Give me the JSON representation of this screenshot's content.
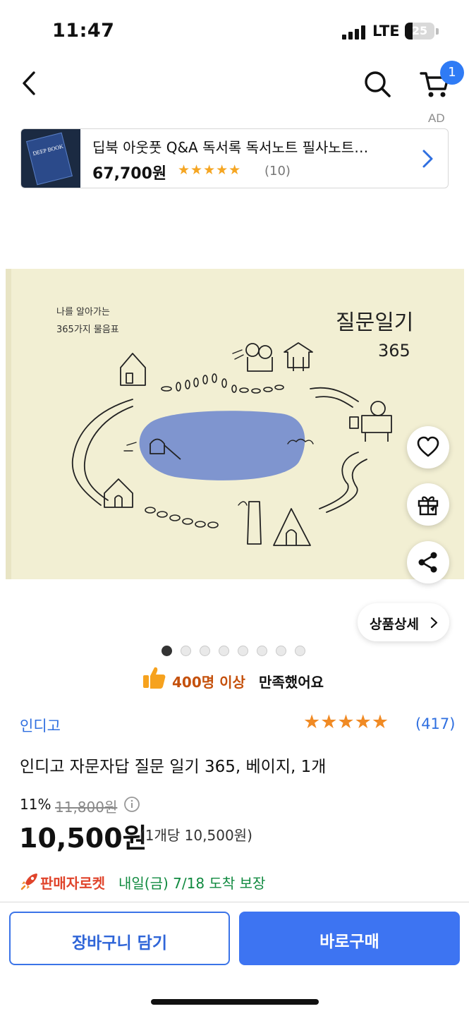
{
  "status_bar": {
    "time": "11:47",
    "network": "LTE",
    "battery": "25",
    "battery_level": 0.25
  },
  "nav": {
    "back_icon": "chevron-left-icon",
    "search_icon": "search-icon",
    "cart_icon": "cart-icon",
    "cart_badge": "1"
  },
  "ad": {
    "label": "AD",
    "title": "딥북 아웃풋 Q&A 독서록 독서노트 필사노트…",
    "price": "67,700원",
    "stars": "★★★★★",
    "rating": 5,
    "reviews": "(10)",
    "thumb_text": "DEEP BOOK"
  },
  "cover": {
    "tagline_line1": "나를 알아가는",
    "tagline_line2": "365가지 물음표",
    "title": "질문일기",
    "number": "365"
  },
  "actions": {
    "wishlist_icon": "heart-icon",
    "gift_icon": "gift-icon",
    "share_icon": "share-icon"
  },
  "detail_button": {
    "label": "상품상세"
  },
  "carousel": {
    "total": 8,
    "active": 1
  },
  "satisfaction": {
    "highlight": "400명 이상",
    "rest": "만족했어요"
  },
  "product": {
    "brand": "인디고",
    "stars": "★★★★★",
    "rating": 5,
    "reviews": "(417)",
    "title": "인디고 자문자답 질문 일기 365, 베이지, 1개",
    "discount": "11%",
    "original_price": "11,800원",
    "price": "10,500원",
    "unit_price": "(1개당 10,500원)",
    "seller_rocket": "판매자로켓",
    "delivery": "내일(금) 7/18 도착 보장"
  },
  "bottom": {
    "cart_label": "장바구니 담기",
    "buy_label": "바로구매"
  },
  "colors": {
    "accent": "#3d74f2",
    "rating": "#f08a24",
    "delivery": "#118a40",
    "rocket": "#e0442b",
    "cover_bg": "#f2efd3",
    "lake": "#7f95cf"
  }
}
